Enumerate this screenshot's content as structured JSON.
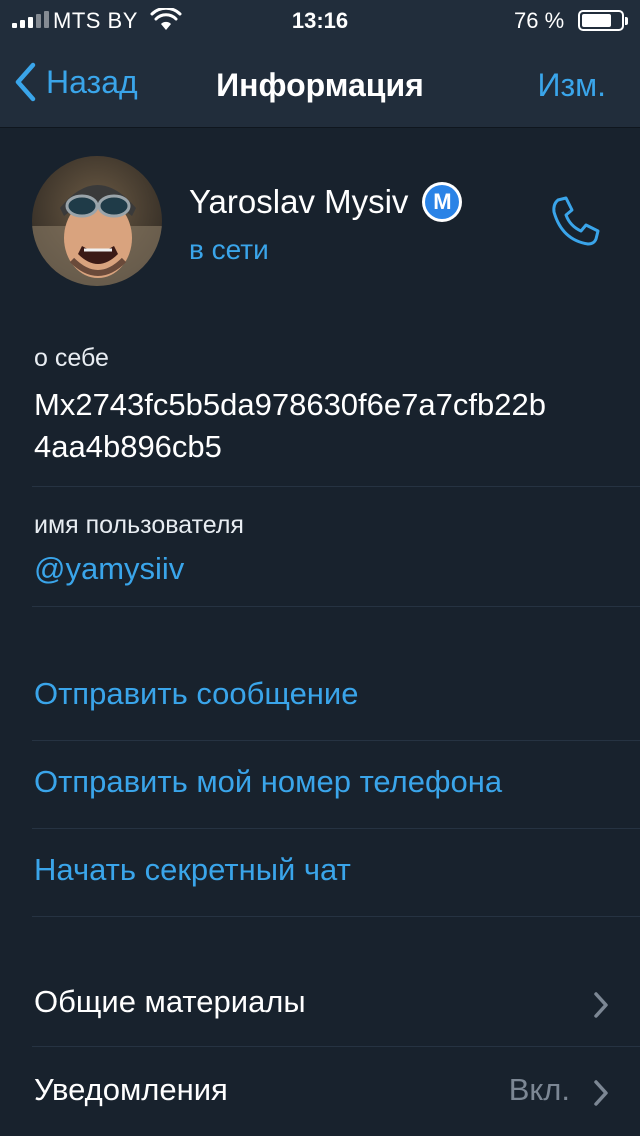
{
  "status_bar": {
    "carrier": "MTS BY",
    "time": "13:16",
    "battery_percent": "76 %",
    "battery_level": 0.76
  },
  "nav": {
    "back_label": "Назад",
    "title": "Информация",
    "edit_label": "Изм."
  },
  "profile": {
    "name": "Yaroslav Mysiv",
    "badge_letter": "M",
    "status": "в сети"
  },
  "bio": {
    "label": "о себе",
    "line1": "Mx2743fc5b5da978630f6e7a7cfb22b",
    "line2": "4aa4b896cb5"
  },
  "username": {
    "label": "имя пользователя",
    "value": "@yamysiiv"
  },
  "actions": [
    {
      "label": "Отправить сообщение"
    },
    {
      "label": "Отправить мой номер телефона"
    },
    {
      "label": "Начать секретный чат"
    }
  ],
  "settings": [
    {
      "label": "Общие материалы",
      "value": ""
    },
    {
      "label": "Уведомления",
      "value": "Вкл."
    }
  ],
  "colors": {
    "background": "#18222d",
    "header": "#212d3b",
    "accent": "#3aa5ea",
    "separator": "#263342",
    "muted": "#7c8794"
  }
}
